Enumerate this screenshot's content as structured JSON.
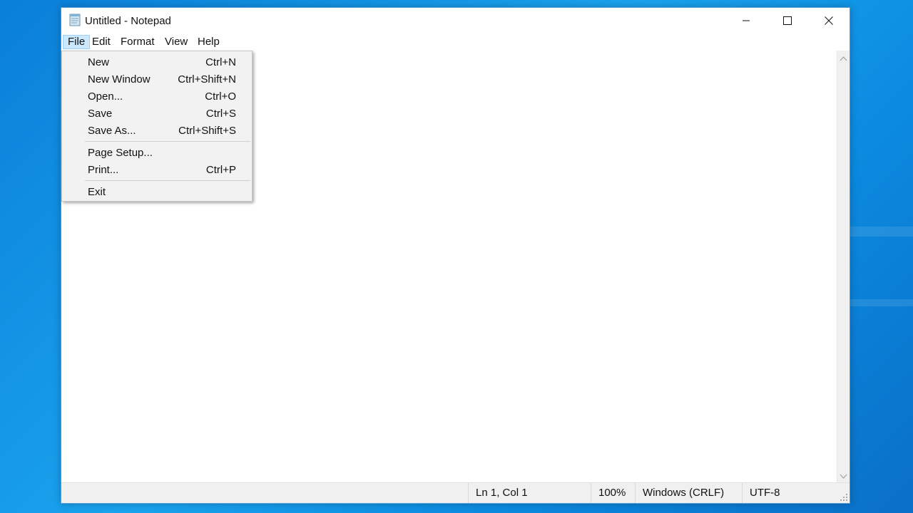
{
  "window": {
    "title": "Untitled - Notepad"
  },
  "menubar": {
    "items": [
      "File",
      "Edit",
      "Format",
      "View",
      "Help"
    ]
  },
  "file_menu": {
    "items": [
      {
        "label": "New",
        "shortcut": "Ctrl+N"
      },
      {
        "label": "New Window",
        "shortcut": "Ctrl+Shift+N"
      },
      {
        "label": "Open...",
        "shortcut": "Ctrl+O"
      },
      {
        "label": "Save",
        "shortcut": "Ctrl+S"
      },
      {
        "label": "Save As...",
        "shortcut": "Ctrl+Shift+S"
      },
      {
        "label": "Page Setup...",
        "shortcut": ""
      },
      {
        "label": "Print...",
        "shortcut": "Ctrl+P"
      },
      {
        "label": "Exit",
        "shortcut": ""
      }
    ]
  },
  "editor": {
    "text": ""
  },
  "statusbar": {
    "position": "Ln 1, Col 1",
    "zoom": "100%",
    "line_ending": "Windows (CRLF)",
    "encoding": "UTF-8"
  },
  "colors": {
    "menu_highlight": "#cce8ff",
    "desktop": "#1aa3ee"
  }
}
